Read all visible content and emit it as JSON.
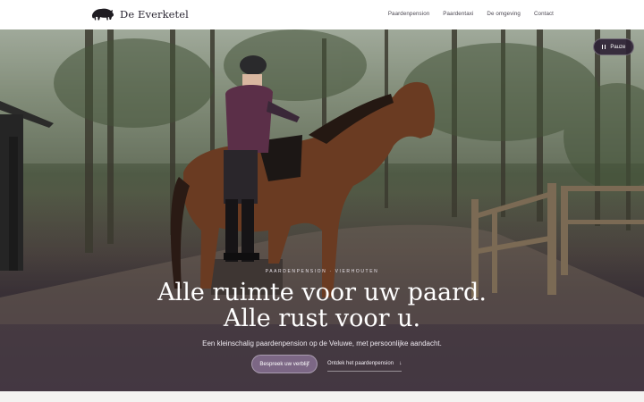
{
  "site": {
    "name": "De Everketel",
    "logo": "boar-silhouette-icon"
  },
  "nav": {
    "items": [
      {
        "label": "Paardenpension"
      },
      {
        "label": "Paardentaxi"
      },
      {
        "label": "De omgeving"
      },
      {
        "label": "Contact"
      }
    ]
  },
  "hero": {
    "eyebrow": "PAARDENPENSION · VIERHOUTEN",
    "headline_line1": "Alle ruimte voor uw paard.",
    "headline_line2": "Alle rust voor u.",
    "subline": "Een kleinschalig paardenpension op de Veluwe, met persoonlijke aandacht.",
    "primary_cta": "Bespreek uw verblijf",
    "secondary_cta": "Ontdek het paardenpension",
    "secondary_icon": "arrow-down-icon",
    "pause_label": "Pauze",
    "pause_icon": "pause-icon"
  },
  "colors": {
    "accent": "#7c6785",
    "overlay": "#30223a",
    "header_bg": "#ffffff"
  }
}
